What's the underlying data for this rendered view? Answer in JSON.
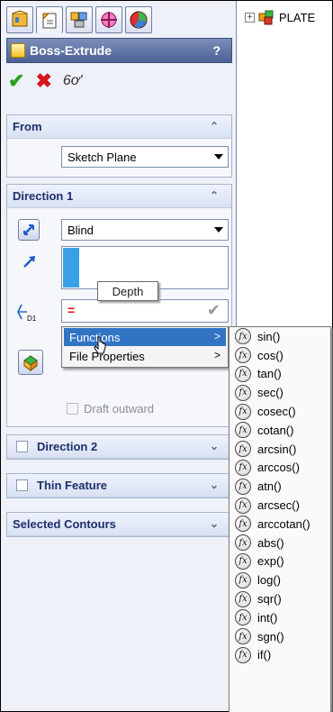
{
  "tree": {
    "root_label": "PLATE"
  },
  "tabs": [
    {
      "name": "feature-manager-icon"
    },
    {
      "name": "property-manager-icon"
    },
    {
      "name": "configuration-manager-icon"
    },
    {
      "name": "dimxpert-manager-icon"
    },
    {
      "name": "display-manager-icon"
    }
  ],
  "property_manager": {
    "title": "Boss-Extrude",
    "help": "?",
    "ok": "✔",
    "cancel": "✖",
    "detail_preview": "6ơ'"
  },
  "from": {
    "header": "From",
    "start_condition": "Sketch Plane"
  },
  "direction1": {
    "header": "Direction 1",
    "end_condition": "Blind",
    "depth_prefix": "=",
    "depth_label": "D1",
    "tooltip": "Depth",
    "draft_outward": "Draft outward"
  },
  "direction2": {
    "header": "Direction 2"
  },
  "thin_feature": {
    "header": "Thin Feature"
  },
  "selected_contours": {
    "header": "Selected Contours"
  },
  "context_menu": {
    "items": [
      {
        "label": "Functions",
        "submenu": ">"
      },
      {
        "label": "File Properties",
        "submenu": ">"
      }
    ]
  },
  "functions_menu": {
    "icon_label": "fx",
    "items": [
      "sin()",
      "cos()",
      "tan()",
      "sec()",
      "cosec()",
      "cotan()",
      "arcsin()",
      "arccos()",
      "atn()",
      "arcsec()",
      "arccotan()",
      "abs()",
      "exp()",
      "log()",
      "sqr()",
      "int()",
      "sgn()",
      "if()"
    ]
  },
  "colors": {
    "title_bar": "#5a6fa3",
    "menu_highlight": "#3274c4",
    "ok_green": "#2aa024",
    "cancel_red": "#d8161c",
    "list_selection": "#3aa0e6"
  }
}
